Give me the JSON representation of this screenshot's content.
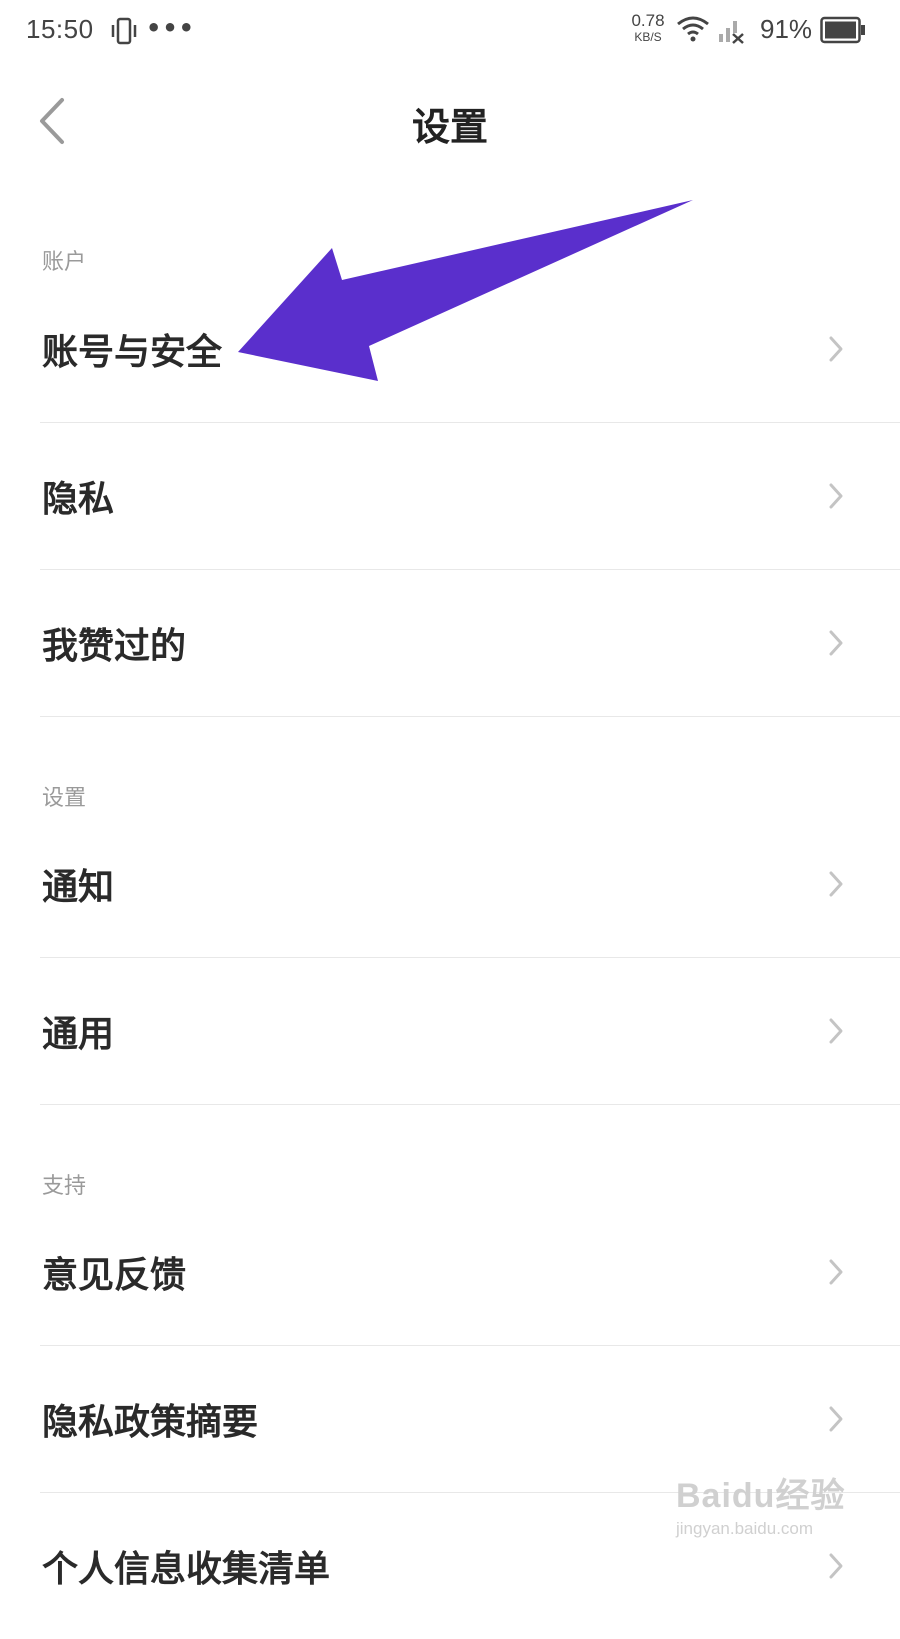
{
  "status_bar": {
    "time": "15:50",
    "dots": "•••",
    "net_speed_value": "0.78",
    "net_speed_unit": "KB/S",
    "battery_percent": "91%",
    "icons": [
      "vibrate-icon",
      "more-dots-icon",
      "wifi-icon",
      "signal-off-icon",
      "battery-icon"
    ]
  },
  "header": {
    "title": "设置",
    "back_icon": "chevron-left-icon"
  },
  "sections": [
    {
      "header": "账户",
      "items": [
        {
          "label": "账号与安全"
        },
        {
          "label": "隐私"
        },
        {
          "label": "我赞过的"
        }
      ]
    },
    {
      "header": "设置",
      "items": [
        {
          "label": "通知"
        },
        {
          "label": "通用"
        }
      ]
    },
    {
      "header": "支持",
      "items": [
        {
          "label": "意见反馈"
        },
        {
          "label": "隐私政策摘要"
        },
        {
          "label": "个人信息收集清单"
        }
      ]
    }
  ],
  "annotation": {
    "color": "#5a2fcc",
    "icon": "pointer-arrow-annotation"
  },
  "watermark": {
    "brand": "Baidu经验",
    "site": "jingyan.baidu.com"
  },
  "colors": {
    "divider": "#e8e8e8",
    "section_header": "#9a9a9a",
    "chevron": "#c4c4c4"
  }
}
